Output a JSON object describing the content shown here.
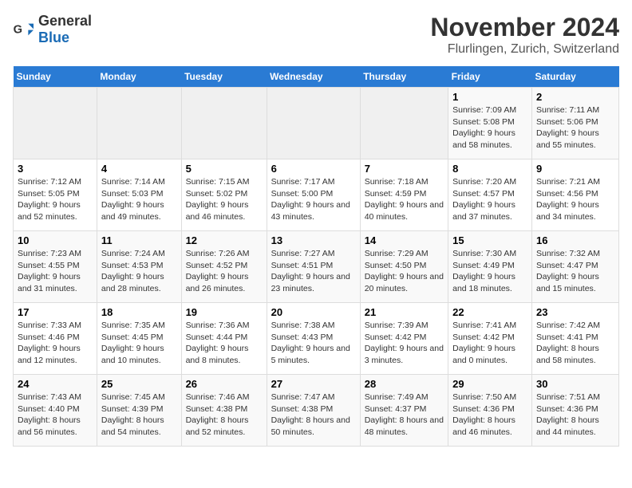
{
  "header": {
    "logo_general": "General",
    "logo_blue": "Blue",
    "month_title": "November 2024",
    "location": "Flurlingen, Zurich, Switzerland"
  },
  "weekdays": [
    "Sunday",
    "Monday",
    "Tuesday",
    "Wednesday",
    "Thursday",
    "Friday",
    "Saturday"
  ],
  "weeks": [
    [
      {
        "day": "",
        "info": ""
      },
      {
        "day": "",
        "info": ""
      },
      {
        "day": "",
        "info": ""
      },
      {
        "day": "",
        "info": ""
      },
      {
        "day": "",
        "info": ""
      },
      {
        "day": "1",
        "info": "Sunrise: 7:09 AM\nSunset: 5:08 PM\nDaylight: 9 hours and 58 minutes."
      },
      {
        "day": "2",
        "info": "Sunrise: 7:11 AM\nSunset: 5:06 PM\nDaylight: 9 hours and 55 minutes."
      }
    ],
    [
      {
        "day": "3",
        "info": "Sunrise: 7:12 AM\nSunset: 5:05 PM\nDaylight: 9 hours and 52 minutes."
      },
      {
        "day": "4",
        "info": "Sunrise: 7:14 AM\nSunset: 5:03 PM\nDaylight: 9 hours and 49 minutes."
      },
      {
        "day": "5",
        "info": "Sunrise: 7:15 AM\nSunset: 5:02 PM\nDaylight: 9 hours and 46 minutes."
      },
      {
        "day": "6",
        "info": "Sunrise: 7:17 AM\nSunset: 5:00 PM\nDaylight: 9 hours and 43 minutes."
      },
      {
        "day": "7",
        "info": "Sunrise: 7:18 AM\nSunset: 4:59 PM\nDaylight: 9 hours and 40 minutes."
      },
      {
        "day": "8",
        "info": "Sunrise: 7:20 AM\nSunset: 4:57 PM\nDaylight: 9 hours and 37 minutes."
      },
      {
        "day": "9",
        "info": "Sunrise: 7:21 AM\nSunset: 4:56 PM\nDaylight: 9 hours and 34 minutes."
      }
    ],
    [
      {
        "day": "10",
        "info": "Sunrise: 7:23 AM\nSunset: 4:55 PM\nDaylight: 9 hours and 31 minutes."
      },
      {
        "day": "11",
        "info": "Sunrise: 7:24 AM\nSunset: 4:53 PM\nDaylight: 9 hours and 28 minutes."
      },
      {
        "day": "12",
        "info": "Sunrise: 7:26 AM\nSunset: 4:52 PM\nDaylight: 9 hours and 26 minutes."
      },
      {
        "day": "13",
        "info": "Sunrise: 7:27 AM\nSunset: 4:51 PM\nDaylight: 9 hours and 23 minutes."
      },
      {
        "day": "14",
        "info": "Sunrise: 7:29 AM\nSunset: 4:50 PM\nDaylight: 9 hours and 20 minutes."
      },
      {
        "day": "15",
        "info": "Sunrise: 7:30 AM\nSunset: 4:49 PM\nDaylight: 9 hours and 18 minutes."
      },
      {
        "day": "16",
        "info": "Sunrise: 7:32 AM\nSunset: 4:47 PM\nDaylight: 9 hours and 15 minutes."
      }
    ],
    [
      {
        "day": "17",
        "info": "Sunrise: 7:33 AM\nSunset: 4:46 PM\nDaylight: 9 hours and 12 minutes."
      },
      {
        "day": "18",
        "info": "Sunrise: 7:35 AM\nSunset: 4:45 PM\nDaylight: 9 hours and 10 minutes."
      },
      {
        "day": "19",
        "info": "Sunrise: 7:36 AM\nSunset: 4:44 PM\nDaylight: 9 hours and 8 minutes."
      },
      {
        "day": "20",
        "info": "Sunrise: 7:38 AM\nSunset: 4:43 PM\nDaylight: 9 hours and 5 minutes."
      },
      {
        "day": "21",
        "info": "Sunrise: 7:39 AM\nSunset: 4:42 PM\nDaylight: 9 hours and 3 minutes."
      },
      {
        "day": "22",
        "info": "Sunrise: 7:41 AM\nSunset: 4:42 PM\nDaylight: 9 hours and 0 minutes."
      },
      {
        "day": "23",
        "info": "Sunrise: 7:42 AM\nSunset: 4:41 PM\nDaylight: 8 hours and 58 minutes."
      }
    ],
    [
      {
        "day": "24",
        "info": "Sunrise: 7:43 AM\nSunset: 4:40 PM\nDaylight: 8 hours and 56 minutes."
      },
      {
        "day": "25",
        "info": "Sunrise: 7:45 AM\nSunset: 4:39 PM\nDaylight: 8 hours and 54 minutes."
      },
      {
        "day": "26",
        "info": "Sunrise: 7:46 AM\nSunset: 4:38 PM\nDaylight: 8 hours and 52 minutes."
      },
      {
        "day": "27",
        "info": "Sunrise: 7:47 AM\nSunset: 4:38 PM\nDaylight: 8 hours and 50 minutes."
      },
      {
        "day": "28",
        "info": "Sunrise: 7:49 AM\nSunset: 4:37 PM\nDaylight: 8 hours and 48 minutes."
      },
      {
        "day": "29",
        "info": "Sunrise: 7:50 AM\nSunset: 4:36 PM\nDaylight: 8 hours and 46 minutes."
      },
      {
        "day": "30",
        "info": "Sunrise: 7:51 AM\nSunset: 4:36 PM\nDaylight: 8 hours and 44 minutes."
      }
    ]
  ]
}
